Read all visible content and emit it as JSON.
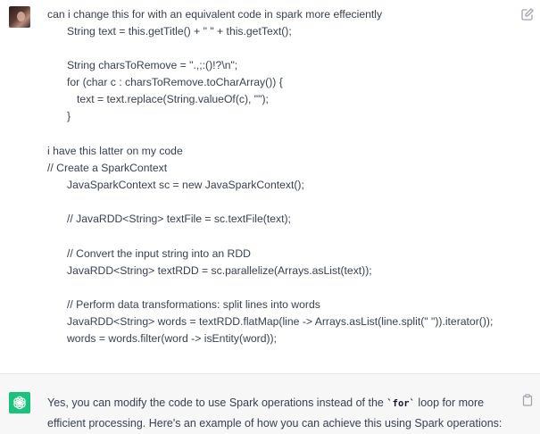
{
  "user_message": {
    "lines": [
      "can i change this for with an equivalent code in spark more effeciently",
      "String text = this.getTitle() + \" \" + this.getText();",
      "",
      "String charsToRemove = \".,;:()!?\\n\";",
      "for (char c : charsToRemove.toCharArray()) {",
      "text = text.replace(String.valueOf(c), \"\");",
      "}",
      "",
      "i have this latter on my code",
      "// Create a SparkContext",
      "JavaSparkContext sc = new JavaSparkContext();",
      "",
      "// JavaRDD<String> textFile = sc.textFile(text);",
      "",
      "// Convert the input string into an RDD",
      "JavaRDD<String> textRDD = sc.parallelize(Arrays.asList(text));",
      "",
      "// Perform data transformations: split lines into words",
      "JavaRDD<String> words = textRDD.flatMap(line -> Arrays.asList(line.split(\" \")).iterator());",
      "words = words.filter(word -> isEntity(word));"
    ]
  },
  "assistant_message": {
    "text_before_code": "Yes, you can modify the code to use Spark operations instead of the ",
    "inline_code": "`for`",
    "text_after_code": " loop for more efficient processing. Here's an example of how you can achieve this using Spark operations:"
  },
  "icons": {
    "avatar": "user-avatar",
    "edit": "edit-icon",
    "assistant_logo": "chatgpt-logo-icon",
    "copy": "clipboard-icon"
  },
  "colors": {
    "assistant_logo_bg": "#19c37d",
    "assistant_bg": "#f7f7f8",
    "text": "#374151"
  }
}
